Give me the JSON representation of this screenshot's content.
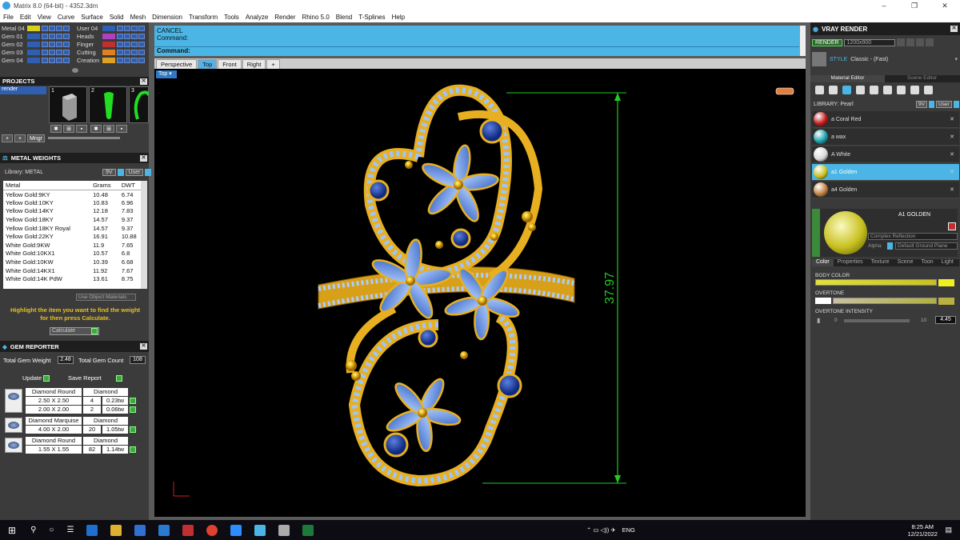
{
  "window": {
    "title": "Matrix 8.0 (64-bit) - 4352.3dm",
    "controls": [
      "–",
      "❐",
      "✕"
    ]
  },
  "menu": [
    "File",
    "Edit",
    "View",
    "Curve",
    "Surface",
    "Solid",
    "Mesh",
    "Dimension",
    "Transform",
    "Tools",
    "Analyze",
    "Render",
    "Rhino 5.0",
    "Blend",
    "T-Splines",
    "Help"
  ],
  "layers": {
    "left": [
      {
        "name": "Metal 04",
        "color": "#d8d020"
      },
      {
        "name": "Gem 01",
        "color": "#2f5fb0"
      },
      {
        "name": "Gem 02",
        "color": "#2f5fb0"
      },
      {
        "name": "Gem 03",
        "color": "#2f5fb0"
      },
      {
        "name": "Gem 04",
        "color": "#2f5fb0"
      }
    ],
    "right": [
      {
        "name": "User 04",
        "color": "#2f5fb0"
      },
      {
        "name": "Heads",
        "color": "#b040c0"
      },
      {
        "name": "Finger",
        "color": "#c03030"
      },
      {
        "name": "Cutting",
        "color": "#e08020"
      },
      {
        "name": "Creation",
        "color": "#e0a020"
      }
    ]
  },
  "projects": {
    "title": "PROJECTS",
    "item": "render",
    "thumbs": [
      "1",
      "2",
      "3"
    ],
    "mngr": "Mngr"
  },
  "metal_weights": {
    "title": "METAL WEIGHTS",
    "library": "Library: METAL",
    "lib_btns": [
      "9V",
      "User"
    ],
    "headers": [
      "Metal",
      "Grams",
      "DWT"
    ],
    "rows": [
      [
        "Yellow Gold:9KY",
        "10.48",
        "6.74"
      ],
      [
        "Yellow Gold:10KY",
        "10.83",
        "6.96"
      ],
      [
        "Yellow Gold:14KY",
        "12.18",
        "7.83"
      ],
      [
        "Yellow Gold:18KY",
        "14.57",
        "9.37"
      ],
      [
        "Yellow Gold:18KY Royal",
        "14.57",
        "9.37"
      ],
      [
        "Yellow Gold:22KY",
        "16.91",
        "10.88"
      ],
      [
        "White Gold:9KW",
        "11.9",
        "7.65"
      ],
      [
        "White Gold:10KX1",
        "10.57",
        "6.8"
      ],
      [
        "White Gold:10KW",
        "10.39",
        "6.68"
      ],
      [
        "White Gold:14KX1",
        "11.92",
        "7.67"
      ],
      [
        "White Gold:14K PdW",
        "13.61",
        "8.75"
      ]
    ],
    "use_obj": "Use Object Materials",
    "hint": "Highlight the item you want to find the weight for then press Calculate.",
    "calc": "Calculate"
  },
  "gem_reporter": {
    "title": "GEM REPORTER",
    "total_weight_label": "Total Gem Weight",
    "total_weight": "2.48",
    "total_count_label": "Total Gem Count",
    "total_count": "108",
    "update": "Update",
    "save": "Save Report",
    "groups": [
      {
        "name": "Diamond Round",
        "type": "Diamond",
        "rows": [
          [
            "2.50 X 2.50",
            "4",
            "0.23tw"
          ],
          [
            "2.00 X 2.00",
            "2",
            "0.06tw"
          ]
        ]
      },
      {
        "name": "Diamond Marquise",
        "type": "Diamond",
        "rows": [
          [
            "4.00 X 2.00",
            "20",
            "1.05tw"
          ]
        ]
      },
      {
        "name": "Diamond Round",
        "type": "Diamond",
        "rows": [
          [
            "1.55 X 1.55",
            "82",
            "1.14tw"
          ]
        ]
      }
    ]
  },
  "command": {
    "line1": "CANCEL",
    "line2": "Command:",
    "prompt": "Command:"
  },
  "viewtabs": [
    "Perspective",
    "Top",
    "Front",
    "Right",
    "+"
  ],
  "active_view": "Top",
  "dimension": "37.97",
  "vray": {
    "title": "VRAY RENDER",
    "render": "RENDER",
    "resolution": "1200x900",
    "style_label": "STYLE",
    "style": "Classic - (Fast)",
    "tabs": [
      "Material Editor",
      "Scene Editor"
    ],
    "library": "LIBRARY: Pearl",
    "materials": [
      {
        "name": "a Coral Red",
        "color": "#c01818"
      },
      {
        "name": "a wax",
        "color": "#18a0a8"
      },
      {
        "name": "A White",
        "color": "#d8d8d8"
      },
      {
        "name": "a1 Golden",
        "color": "#c8c020",
        "selected": true
      },
      {
        "name": "a4 Golden",
        "color": "#c08040"
      }
    ],
    "preview_name": "A1 GOLDEN",
    "reflection": "Complex Reflection",
    "alpha": "Alpha",
    "ground": "Default Ground Plane",
    "subtabs": [
      "Color",
      "Properties",
      "Texture",
      "Scene",
      "Toon",
      "Light"
    ],
    "body_color": "BODY COLOR",
    "overtone": "OVERTONE",
    "overtone_intensity": "OVERTONE INTENSITY",
    "intensity_min": "0",
    "intensity_max": "10",
    "intensity_value": "4.45"
  },
  "taskbar": {
    "time": "8:25 AM",
    "date": "12/21/2022",
    "lang": "ENG"
  }
}
